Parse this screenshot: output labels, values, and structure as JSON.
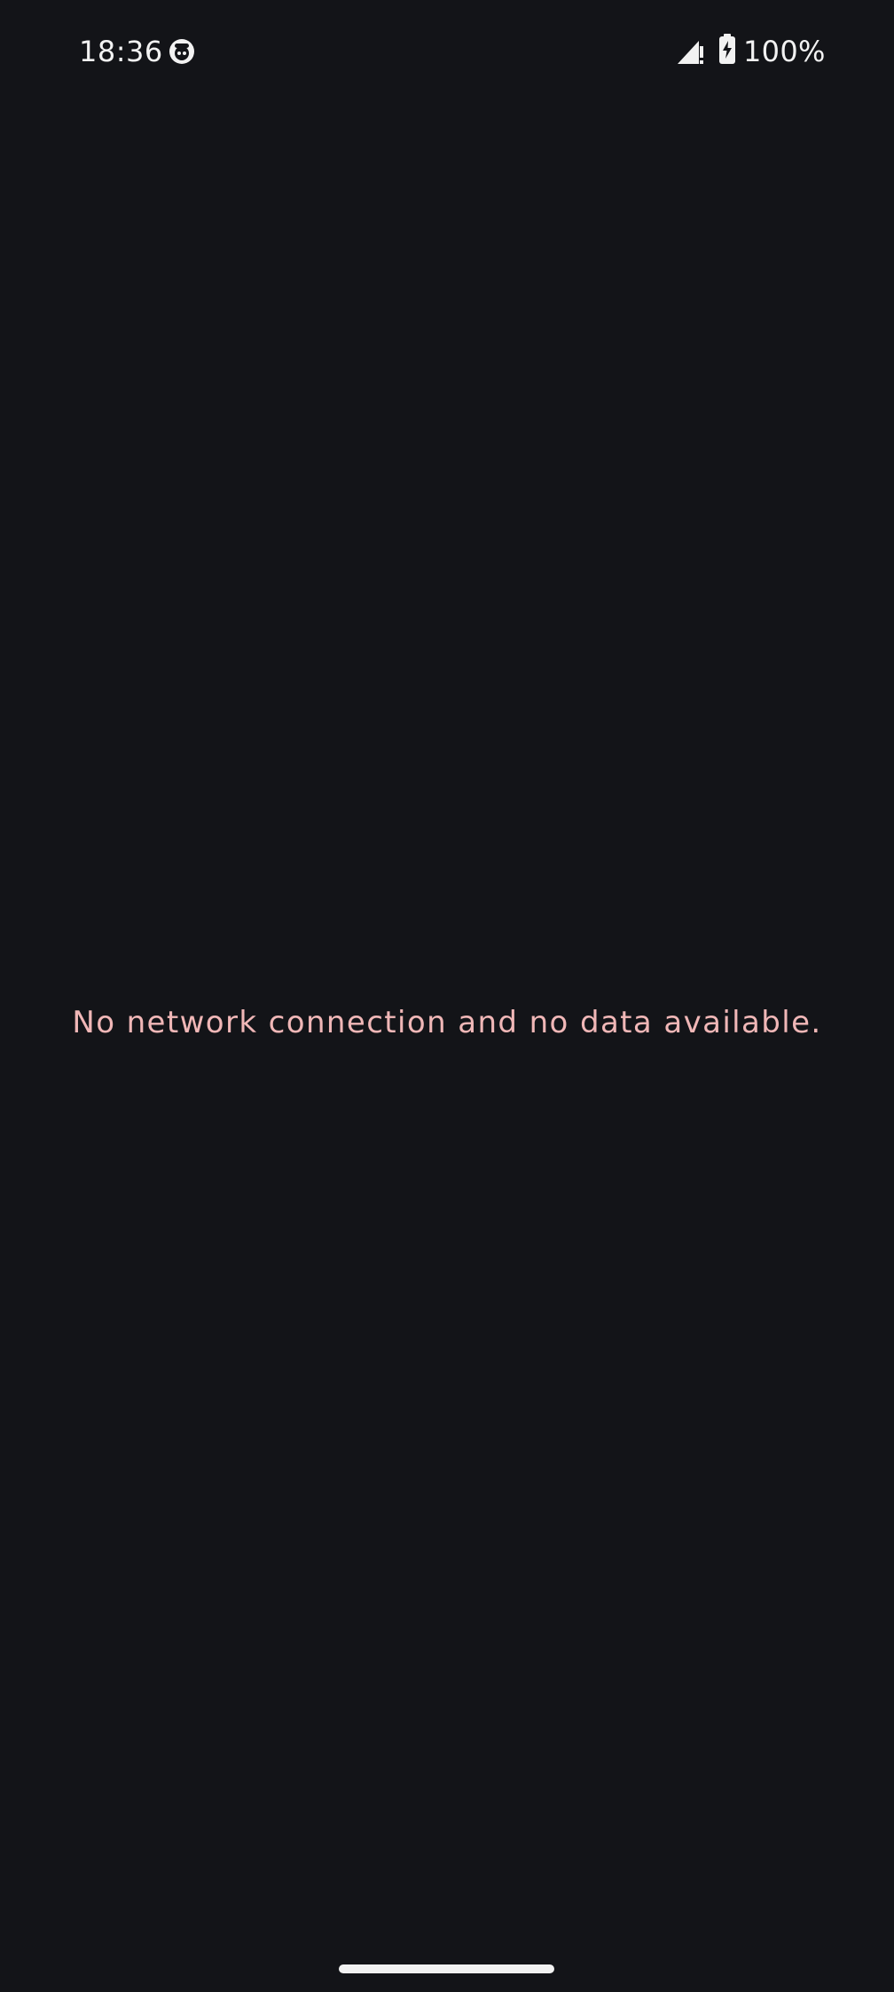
{
  "status_bar": {
    "time": "18:36",
    "battery_percent": "100%",
    "icons": [
      "app-notification-icon",
      "signal-icon",
      "battery-charging-icon"
    ]
  },
  "content": {
    "message": "No network connection and no data available."
  },
  "colors": {
    "background": "#131418",
    "status_text": "#f2f2f2",
    "message_text": "#f0b7b7",
    "home_indicator": "#f2f2f2"
  }
}
